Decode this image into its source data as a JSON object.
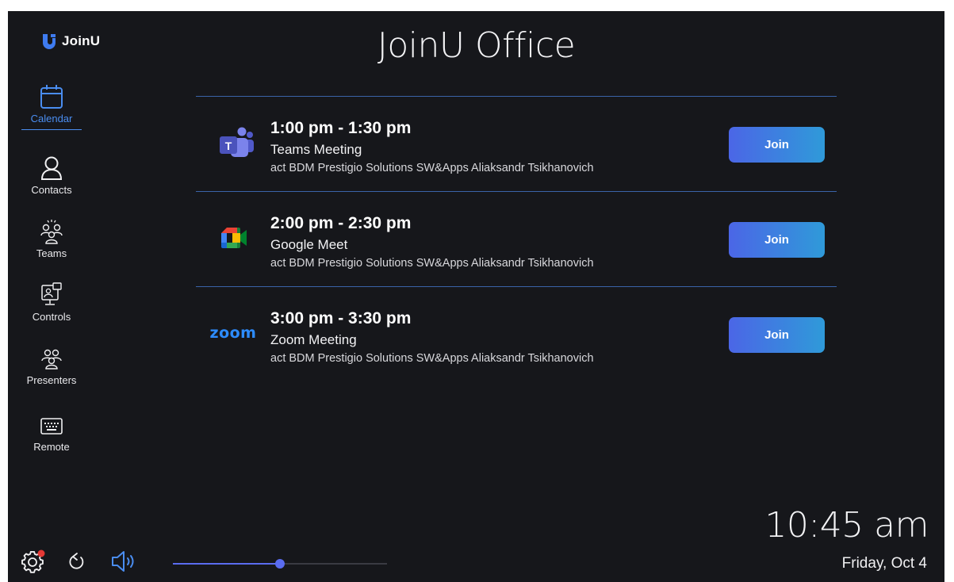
{
  "app": {
    "brand": "JoinU",
    "title": "JoinU Office"
  },
  "nav": {
    "items": [
      {
        "label": "Calendar",
        "icon": "calendar-icon",
        "active": true
      },
      {
        "label": "Contacts",
        "icon": "contact-icon"
      },
      {
        "label": "Teams",
        "icon": "teams-icon"
      },
      {
        "label": "Controls",
        "icon": "controls-icon"
      },
      {
        "label": "Presenters",
        "icon": "presenters-icon"
      },
      {
        "label": "Remote",
        "icon": "keyboard-icon"
      }
    ]
  },
  "meetings": [
    {
      "time": "1:00 pm - 1:30 pm",
      "name": "Teams Meeting",
      "org": "act BDM Prestigio Solutions SW&Apps Aliaksandr Tsikhanovich",
      "platform": "microsoft-teams-icon",
      "join_label": "Join"
    },
    {
      "time": "2:00 pm - 2:30 pm",
      "name": "Google Meet",
      "org": "act BDM Prestigio Solutions SW&Apps Aliaksandr Tsikhanovich",
      "platform": "google-meet-icon",
      "join_label": "Join"
    },
    {
      "time": "3:00 pm - 3:30 pm",
      "name": "Zoom Meeting",
      "org": "act BDM Prestigio Solutions SW&Apps Aliaksandr Tsikhanovich",
      "platform": "zoom-logo",
      "platform_text": "zoom",
      "join_label": "Join"
    }
  ],
  "clock": {
    "time": "10:45 am",
    "date": "Friday, Oct 4"
  },
  "volume": {
    "level": 0.5
  },
  "colors": {
    "background": "#16171b",
    "accent": "#4a8df0",
    "join_gradient_start": "#4b66e6",
    "join_gradient_end": "#2f9ad9",
    "notification_dot": "#e53935"
  }
}
